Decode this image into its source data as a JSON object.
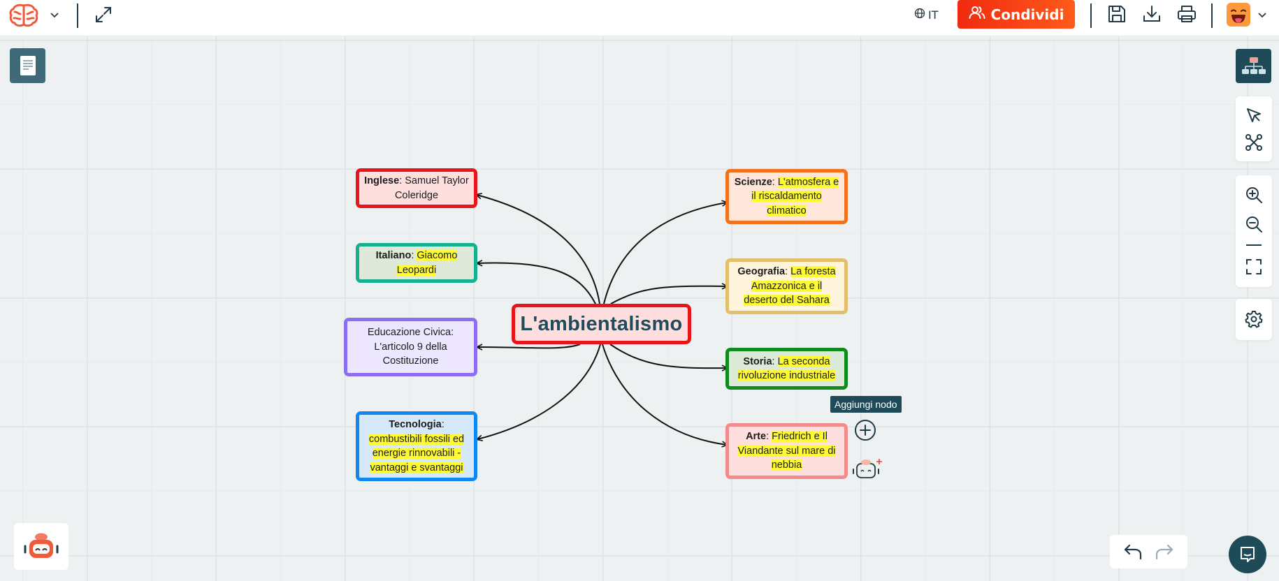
{
  "toolbar": {
    "lang_code": "IT",
    "share_label": "Condividi",
    "brand_color": "#f02b10"
  },
  "map": {
    "center": "L'ambientalismo",
    "nodes": {
      "inglese": {
        "subject": "Inglese",
        "sep": ": ",
        "plain": "Samuel Taylor Coleridge",
        "highlight": "",
        "border": "#e8141b",
        "fill": "#ffdede"
      },
      "italiano": {
        "subject": "Italiano",
        "sep": ": ",
        "plain": "",
        "highlight": "Giacomo Leopardi",
        "border": "#16b08f",
        "fill": "#dfe9d9"
      },
      "civica": {
        "subject": "",
        "sep": "",
        "plain": "Educazione Civica: L'articolo 9 della Costituzione",
        "highlight": "",
        "border": "#8c6ff0",
        "fill": "#ece6ff"
      },
      "tecnologia": {
        "subject": "Tecnologia",
        "sep": ": ",
        "plain": "",
        "highlight": "combustibili fossili ed energie rinnovabili - vantaggi e svantaggi",
        "border": "#1188f0",
        "fill": "#d6e9fb"
      },
      "scienze": {
        "subject": "Scienze",
        "sep": ": ",
        "plain": "",
        "highlight": "L'atmosfera e il riscaldamento climatico",
        "border": "#f2711c",
        "fill": "#ffe5da"
      },
      "geografia": {
        "subject": "Geografia",
        "sep": ": ",
        "plain": "",
        "highlight": "La foresta Amazzonica e il deserto del Sahara",
        "border": "#e4bf6b",
        "fill": "#fff5dd"
      },
      "storia": {
        "subject": "Storia",
        "sep": ": ",
        "plain": "",
        "highlight": "La seconda rivoluzione industriale",
        "border": "#0f8a1c",
        "fill": "#dcead9"
      },
      "arte": {
        "subject": "Arte",
        "sep": ": ",
        "plain": "",
        "highlight": "Friedrich e Il Viandante sul mare di nebbia",
        "border": "#f28b8b",
        "fill": "#ffdede"
      }
    },
    "add_node_tooltip": "Aggiungi nodo"
  },
  "icons": {
    "logo": "brain-logo-icon",
    "expand": "expand-icon",
    "globe": "globe-icon",
    "share": "users-icon",
    "save": "save-icon",
    "download": "download-icon",
    "print": "print-icon",
    "avatar": "emoji-avatar",
    "doc": "document-icon",
    "layout": "hierarchy-layout-icon",
    "select": "cursor-icon",
    "connect": "connect-nodes-icon",
    "zoom_in": "zoom-in-icon",
    "zoom_out": "zoom-out-icon",
    "fit": "fit-screen-icon",
    "settings": "gear-icon",
    "ai": "robot-icon",
    "undo": "undo-icon",
    "redo": "redo-icon",
    "chat": "chat-icon",
    "add": "plus-circle-icon"
  }
}
